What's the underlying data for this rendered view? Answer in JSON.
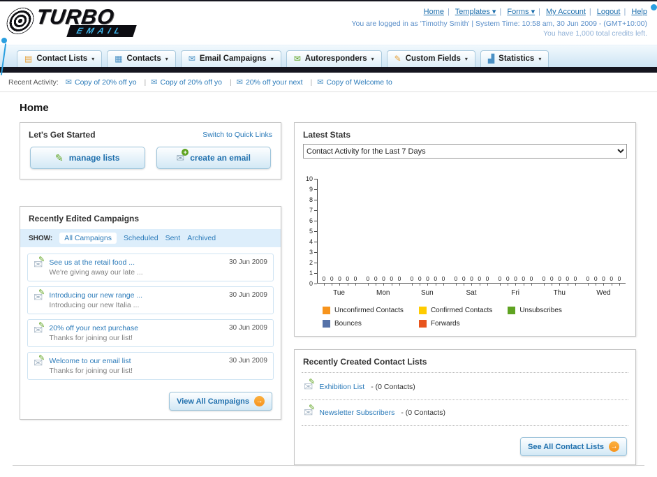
{
  "icons": {
    "envelope": "✉",
    "pencil": "✎",
    "plus": "+",
    "dropdown_arrow": "▾",
    "arrow_right": "→"
  },
  "header": {
    "logo_title": "TURBO",
    "logo_subtitle": "EMAIL",
    "nav_links": [
      {
        "label": "Home"
      },
      {
        "label": "Templates ▾"
      },
      {
        "label": "Forms ▾"
      },
      {
        "label": "My Account"
      },
      {
        "label": "Logout"
      },
      {
        "label": "Help"
      }
    ],
    "login_info": "You are logged in as 'Timothy Smith' | System Time: 10:58 am, 30 Jun 2009 - (GMT+10:00)",
    "credits_info": "You have 1,000 total credits left."
  },
  "main_nav": {
    "tabs": [
      {
        "label": "Contact Lists",
        "icon_glyph": "▤",
        "icon_color": "#e8a33d"
      },
      {
        "label": "Contacts",
        "icon_glyph": "▦",
        "icon_color": "#4a90c4"
      },
      {
        "label": "Email Campaigns",
        "icon_glyph": "✉",
        "icon_color": "#4a90c4"
      },
      {
        "label": "Autoresponders",
        "icon_glyph": "✉",
        "icon_color": "#5fa321"
      },
      {
        "label": "Custom Fields",
        "icon_glyph": "✎",
        "icon_color": "#e8a33d"
      },
      {
        "label": "Statistics",
        "icon_glyph": "▟",
        "icon_color": "#4a90c4"
      }
    ]
  },
  "recent_activity": {
    "label": "Recent Activity:",
    "items": [
      "Copy of 20% off yo",
      "Copy of 20% off yo",
      "20% off your next",
      "Copy of Welcome to"
    ]
  },
  "page_title": "Home",
  "get_started": {
    "title": "Let's Get Started",
    "switch_link": "Switch to Quick Links",
    "buttons": [
      {
        "label": "manage lists"
      },
      {
        "label": "create an email"
      }
    ]
  },
  "campaigns": {
    "title": "Recently Edited Campaigns",
    "show_label": "SHOW:",
    "filters": [
      "All Campaigns",
      "Scheduled",
      "Sent",
      "Archived"
    ],
    "active_filter": "All Campaigns",
    "items": [
      {
        "title": "See us at the retail food ...",
        "subtitle": "We're giving away our late ...",
        "date": "30 Jun 2009"
      },
      {
        "title": "Introducing our new range ...",
        "subtitle": "Introducing our new Italia ...",
        "date": "30 Jun 2009"
      },
      {
        "title": "20% off your next purchase",
        "subtitle": "Thanks for joining our list!",
        "date": "30 Jun 2009"
      },
      {
        "title": "Welcome to our email list",
        "subtitle": "Thanks for joining our list!",
        "date": "30 Jun 2009"
      }
    ],
    "view_all_label": "View All Campaigns"
  },
  "stats": {
    "title": "Latest Stats",
    "dropdown_value": "Contact Activity for the Last 7 Days",
    "chart_data": {
      "type": "bar",
      "title": "Contact Activity for the Last 7 Days",
      "categories": [
        "Tue",
        "Mon",
        "Sun",
        "Sat",
        "Fri",
        "Thu",
        "Wed"
      ],
      "series": [
        {
          "name": "Unconfirmed Contacts",
          "color": "#f7941d",
          "values": [
            0,
            0,
            0,
            0,
            0,
            0,
            0
          ]
        },
        {
          "name": "Confirmed Contacts",
          "color": "#ffcc00",
          "values": [
            0,
            0,
            0,
            0,
            0,
            0,
            0
          ]
        },
        {
          "name": "Unsubscribes",
          "color": "#5fa321",
          "values": [
            0,
            0,
            0,
            0,
            0,
            0,
            0
          ]
        },
        {
          "name": "Bounces",
          "color": "#5572a8",
          "values": [
            0,
            0,
            0,
            0,
            0,
            0,
            0
          ]
        },
        {
          "name": "Forwards",
          "color": "#e8541d",
          "values": [
            0,
            0,
            0,
            0,
            0,
            0,
            0
          ]
        }
      ],
      "ylim": [
        0,
        10
      ],
      "yticks": [
        10,
        9,
        8,
        7,
        6,
        5,
        4,
        3,
        2,
        1,
        0
      ],
      "value_labels_shown": true,
      "legend_position": "bottom",
      "grid": false
    }
  },
  "contact_lists": {
    "title": "Recently Created Contact Lists",
    "items": [
      {
        "name": "Exhibition List",
        "detail": "- (0 Contacts)"
      },
      {
        "name": "Newsletter Subscribers",
        "detail": "- (0 Contacts)"
      }
    ],
    "see_all_label": "See All Contact Lists"
  }
}
